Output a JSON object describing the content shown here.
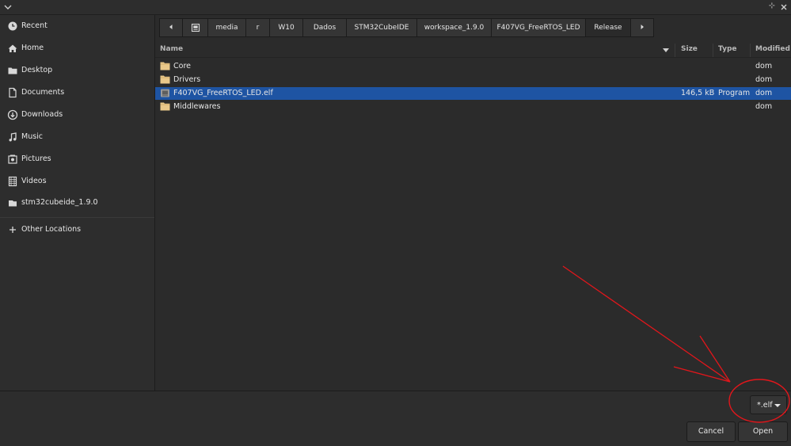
{
  "sidebar": {
    "items": [
      {
        "label": "Recent",
        "icon": "clock-icon"
      },
      {
        "label": "Home",
        "icon": "home-icon"
      },
      {
        "label": "Desktop",
        "icon": "folder-icon"
      },
      {
        "label": "Documents",
        "icon": "document-icon"
      },
      {
        "label": "Downloads",
        "icon": "download-icon"
      },
      {
        "label": "Music",
        "icon": "music-icon"
      },
      {
        "label": "Pictures",
        "icon": "camera-icon"
      },
      {
        "label": "Videos",
        "icon": "film-icon"
      },
      {
        "label": "stm32cubeide_1.9.0",
        "icon": "drive-icon"
      },
      {
        "label": "Other Locations",
        "icon": "plus-icon"
      }
    ]
  },
  "pathbar": {
    "segments": [
      "media",
      "r",
      "W10",
      "Dados",
      "STM32CubeIDE",
      "workspace_1.9.0",
      "F407VG_FreeRTOS_LED",
      "Release"
    ]
  },
  "columns": {
    "name": "Name",
    "size": "Size",
    "type": "Type",
    "modified": "Modified"
  },
  "files": [
    {
      "name": "Core",
      "size": "",
      "type": "",
      "modified": "dom",
      "kind": "folder"
    },
    {
      "name": "Drivers",
      "size": "",
      "type": "",
      "modified": "dom",
      "kind": "folder"
    },
    {
      "name": "F407VG_FreeRTOS_LED.elf",
      "size": "146,5 kB",
      "type": "Program",
      "modified": "dom",
      "kind": "file",
      "selected": true
    },
    {
      "name": "Middlewares",
      "size": "",
      "type": "",
      "modified": "dom",
      "kind": "folder"
    }
  ],
  "filter": {
    "value": "*.elf"
  },
  "buttons": {
    "cancel": "Cancel",
    "open": "Open"
  },
  "colors": {
    "selection": "#1e54a3",
    "annotation": "#e3161b",
    "folder": "#e9c88a"
  }
}
